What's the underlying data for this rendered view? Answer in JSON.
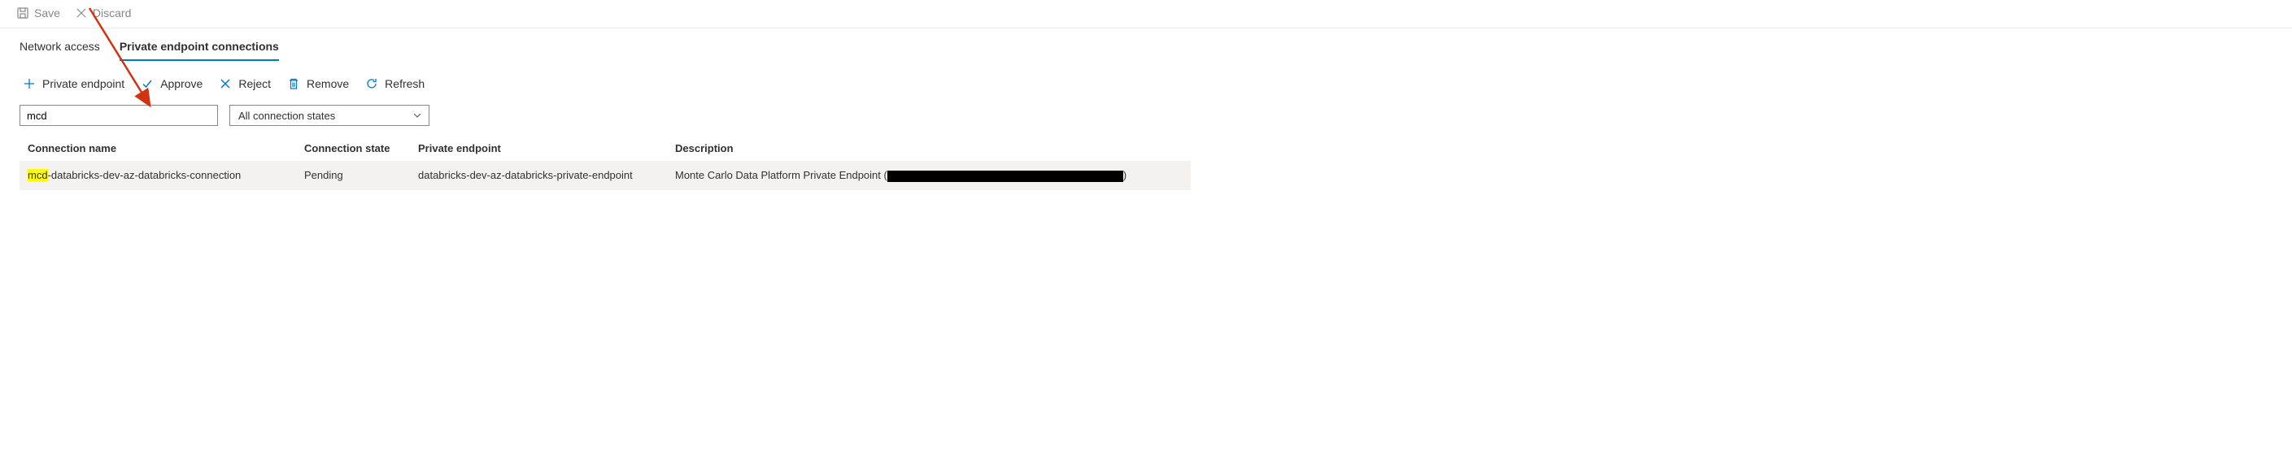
{
  "command_bar": {
    "save_label": "Save",
    "discard_label": "Discard"
  },
  "tabs": {
    "network_access": "Network access",
    "private_endpoint_connections": "Private endpoint connections"
  },
  "actions": {
    "private_endpoint": "Private endpoint",
    "approve": "Approve",
    "reject": "Reject",
    "remove": "Remove",
    "refresh": "Refresh"
  },
  "filters": {
    "search_value": "mcd",
    "state_dropdown": "All connection states"
  },
  "table": {
    "headers": {
      "connection_name": "Connection name",
      "connection_state": "Connection state",
      "private_endpoint": "Private endpoint",
      "description": "Description"
    },
    "rows": [
      {
        "name_hl": "mcd",
        "name_rest": "-databricks-dev-az-databricks-connection",
        "state": "Pending",
        "endpoint": "databricks-dev-az-databricks-private-endpoint",
        "description_pre": "Monte Carlo Data Platform Private Endpoint (",
        "description_post": ")"
      }
    ]
  },
  "annotation": {
    "kind": "red-arrow",
    "target": "approve-button"
  }
}
